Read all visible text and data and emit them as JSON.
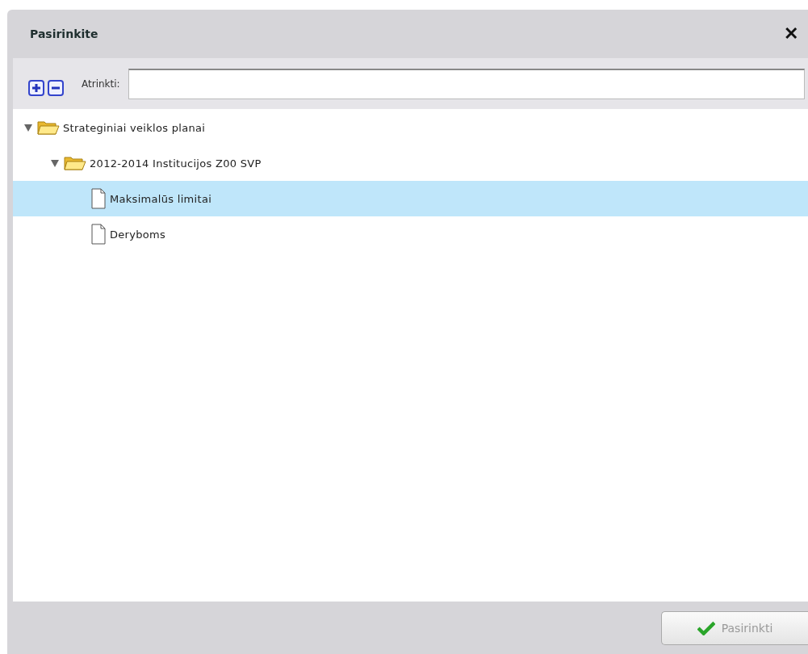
{
  "dialog": {
    "title": "Pasirinkite",
    "close": "✕"
  },
  "toolbar": {
    "filter_label": "Atrinkti:"
  },
  "tree": [
    {
      "label": "Strateginiai veiklos planai",
      "kind": "folder",
      "expanded": true,
      "selected": false,
      "children": [
        {
          "label": "2012-2014 Institucijos Z00 SVP",
          "kind": "folder",
          "expanded": true,
          "selected": false,
          "children": [
            {
              "label": "Maksimalūs limitai",
              "kind": "file",
              "selected": true
            },
            {
              "label": "Deryboms",
              "kind": "file",
              "selected": false
            }
          ]
        }
      ]
    }
  ],
  "footer": {
    "button": {
      "label": "Pasirinkti",
      "disabled": true
    }
  }
}
